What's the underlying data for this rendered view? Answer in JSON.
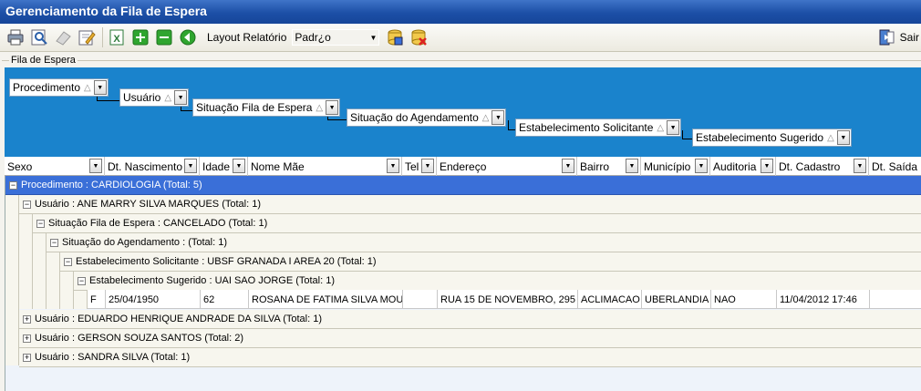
{
  "window": {
    "title": "Gerenciamento da Fila de Espera"
  },
  "toolbar": {
    "report_layout_label": "Layout Relatório",
    "report_layout_value": "Padr¿o",
    "exit_label": "Sair"
  },
  "fieldset": {
    "legend": "Fila de Espera"
  },
  "group_panel": {
    "chips": [
      "Procedimento",
      "Usuário",
      "Situação Fila de Espera",
      "Situação do Agendamento",
      "Estabelecimento Solicitante",
      "Estabelecimento Sugerido"
    ]
  },
  "columns": [
    "Sexo",
    "Dt. Nascimento",
    "Idade",
    "Nome Mãe",
    "Tel",
    "Endereço",
    "Bairro",
    "Município",
    "Auditoria",
    "Dt. Cadastro",
    "Dt. Saída"
  ],
  "groups": {
    "g0": "Procedimento : CARDIOLOGIA (Total: 5)",
    "g1": "Usuário : ANE MARRY SILVA MARQUES (Total: 1)",
    "g2": "Situação Fila de Espera : CANCELADO (Total: 1)",
    "g3": "Situação do Agendamento :  (Total: 1)",
    "g4": "Estabelecimento Solicitante : UBSF GRANADA I AREA 20 (Total: 1)",
    "g5": "Estabelecimento Sugerido : UAI SAO JORGE (Total: 1)",
    "u2": "Usuário : EDUARDO HENRIQUE ANDRADE DA SILVA (Total: 1)",
    "u3": "Usuário : GERSON SOUZA SANTOS (Total: 2)",
    "u4": "Usuário : SANDRA SILVA (Total: 1)"
  },
  "row": {
    "sexo": "F",
    "dt_nascimento": "25/04/1950",
    "idade": "62",
    "nome_mae": "ROSANA DE FATIMA SILVA MOURA",
    "tel": "",
    "endereco": "RUA 15 DE NOVEMBRO, 295  -",
    "bairro": "ACLIMACAO",
    "municipio": "UBERLANDIA",
    "auditoria": "NAO",
    "dt_cadastro": "11/04/2012 17:46",
    "dt_saida": ""
  },
  "icons": [
    "printer-icon",
    "preview-icon",
    "eraser-icon",
    "edit-icon",
    "excel-icon",
    "add-icon",
    "remove-icon",
    "back-icon",
    "save-db-icon",
    "delete-db-icon",
    "exit-icon"
  ],
  "colors": {
    "title_bar": "#1c4fa6",
    "group_panel": "#1a83cc",
    "selected_group_row": "#3a6fd8"
  }
}
